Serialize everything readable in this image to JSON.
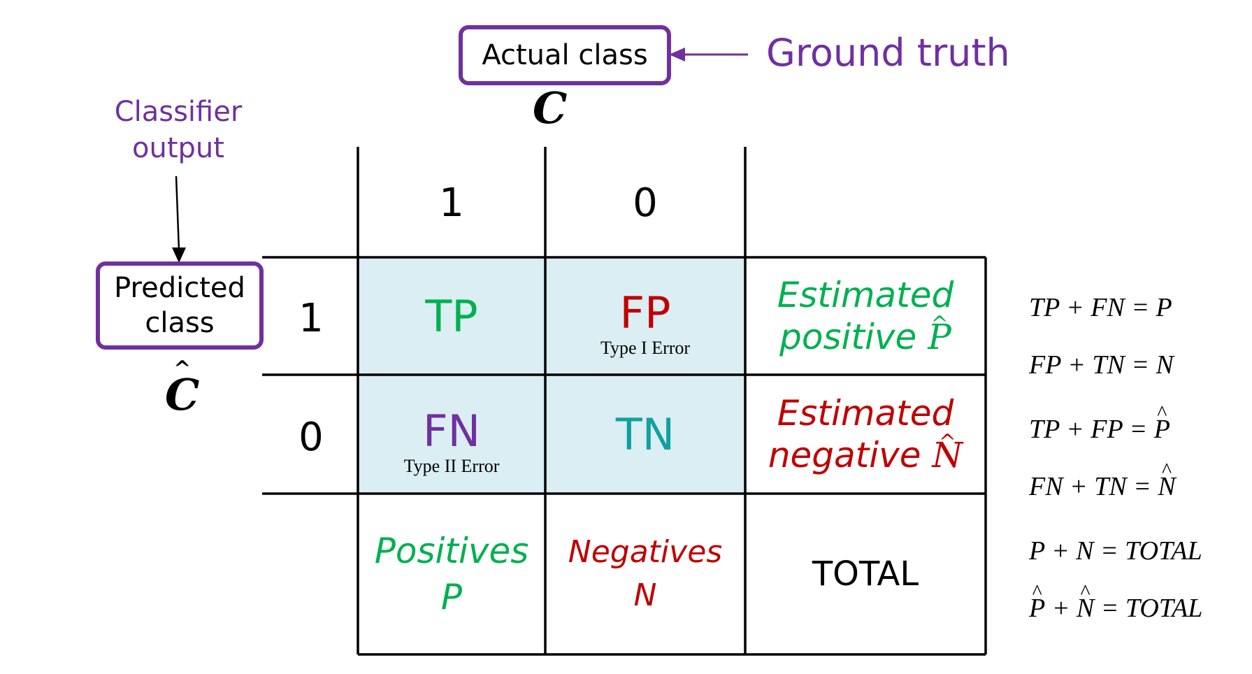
{
  "top": {
    "actual_class_label": "Actual class",
    "actual_symbol": "C",
    "ground_truth_label": "Ground truth"
  },
  "left": {
    "classifier_output_label_line1": "Classifier",
    "classifier_output_label_line2": "output",
    "predicted_class_line1": "Predicted",
    "predicted_class_line2": "class",
    "predicted_symbol": "C"
  },
  "matrix": {
    "col_headers": [
      "1",
      "0"
    ],
    "row_headers": [
      "1",
      "0"
    ],
    "tp": "TP",
    "fp": "FP",
    "fp_note": "Type I Error",
    "fn": "FN",
    "fn_note": "Type II Error",
    "tn": "TN",
    "estimated_positive_line1": "Estimated",
    "estimated_positive_line2": "positive",
    "estimated_positive_symbol": "P",
    "estimated_negative_line1": "Estimated",
    "estimated_negative_line2": "negative",
    "estimated_negative_symbol": "N",
    "positives_label": "Positives",
    "positives_symbol": "P",
    "negatives_label": "Negatives",
    "negatives_symbol": "N",
    "total_label": "TOTAL"
  },
  "equations": [
    "TP + FN = P",
    "FP + TN = N",
    "TP + FP = ",
    "FN + TN = ",
    "P + N = TOTAL",
    " + ",
    " = TOTAL"
  ],
  "equation_symbols": {
    "p": "P",
    "n": "N"
  },
  "colors": {
    "purple": "#7030a0",
    "green": "#00b050",
    "red": "#c00000",
    "teal": "#12a0a0",
    "cell_fill": "#dbeef3"
  }
}
